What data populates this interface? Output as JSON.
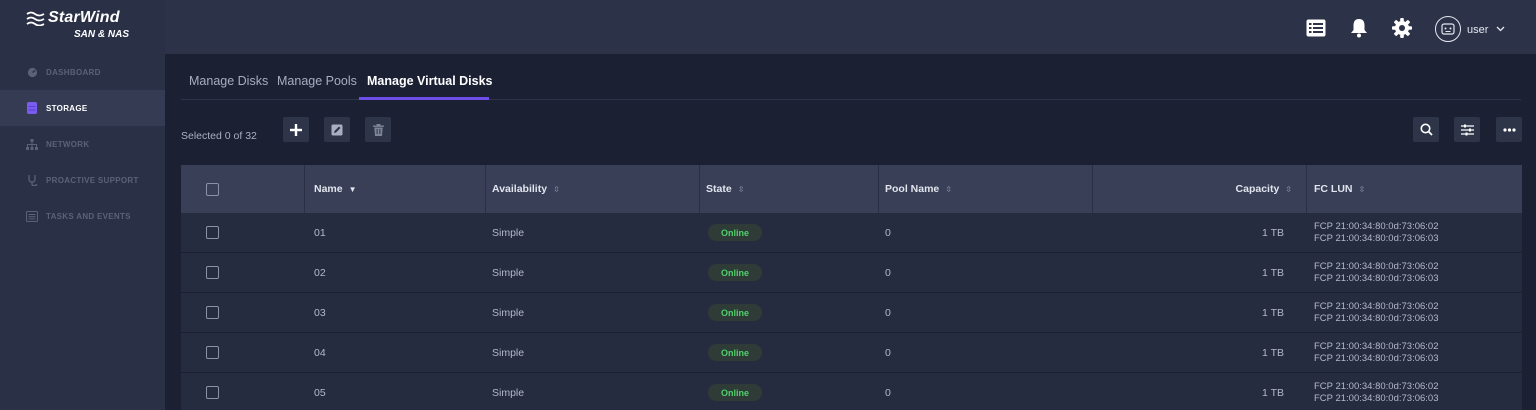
{
  "brand": {
    "title": "StarWind",
    "subtitle": "SAN & NAS"
  },
  "sidebar": {
    "items": [
      {
        "label": "DASHBOARD",
        "icon": "dashboard-icon"
      },
      {
        "label": "STORAGE",
        "icon": "storage-icon",
        "active": true
      },
      {
        "label": "NETWORK",
        "icon": "network-icon"
      },
      {
        "label": "PROACTIVE SUPPORT",
        "icon": "stethoscope-icon"
      },
      {
        "label": "TASKS AND EVENTS",
        "icon": "tasks-icon"
      }
    ]
  },
  "header": {
    "icons": [
      "task-list-icon",
      "bell-icon",
      "gear-icon"
    ],
    "user": {
      "name": "user",
      "avatar_icon": "robot-avatar-icon"
    }
  },
  "tabs": [
    {
      "label": "Manage Disks"
    },
    {
      "label": "Manage Pools"
    },
    {
      "label": "Manage Virtual Disks",
      "active": true
    }
  ],
  "toolbar": {
    "selection_text": "Selected 0 of 32",
    "left_buttons": [
      "add-icon",
      "edit-icon",
      "delete-icon"
    ],
    "right_buttons": [
      "search-icon",
      "filter-settings-icon",
      "more-icon"
    ]
  },
  "table": {
    "columns": [
      {
        "label": "Name",
        "sorted": true
      },
      {
        "label": "Availability"
      },
      {
        "label": "State"
      },
      {
        "label": "Pool Name"
      },
      {
        "label": "Capacity"
      },
      {
        "label": "FC LUN"
      }
    ],
    "rows": [
      {
        "name": "01",
        "availability": "Simple",
        "state": "Online",
        "pool": "0",
        "capacity": "1 TB",
        "lun1": "FCP 21:00:34:80:0d:73:06:02",
        "lun2": "FCP 21:00:34:80:0d:73:06:03"
      },
      {
        "name": "02",
        "availability": "Simple",
        "state": "Online",
        "pool": "0",
        "capacity": "1 TB",
        "lun1": "FCP 21:00:34:80:0d:73:06:02",
        "lun2": "FCP 21:00:34:80:0d:73:06:03"
      },
      {
        "name": "03",
        "availability": "Simple",
        "state": "Online",
        "pool": "0",
        "capacity": "1 TB",
        "lun1": "FCP 21:00:34:80:0d:73:06:02",
        "lun2": "FCP 21:00:34:80:0d:73:06:03"
      },
      {
        "name": "04",
        "availability": "Simple",
        "state": "Online",
        "pool": "0",
        "capacity": "1 TB",
        "lun1": "FCP 21:00:34:80:0d:73:06:02",
        "lun2": "FCP 21:00:34:80:0d:73:06:03"
      },
      {
        "name": "05",
        "availability": "Simple",
        "state": "Online",
        "pool": "0",
        "capacity": "1 TB",
        "lun1": "FCP 21:00:34:80:0d:73:06:02",
        "lun2": "FCP 21:00:34:80:0d:73:06:03"
      }
    ]
  },
  "colors": {
    "sidebar_bg": "#2a3045",
    "content_bg": "#1b2033",
    "accent": "#6d4ee6",
    "online_green": "#4fd06b"
  }
}
